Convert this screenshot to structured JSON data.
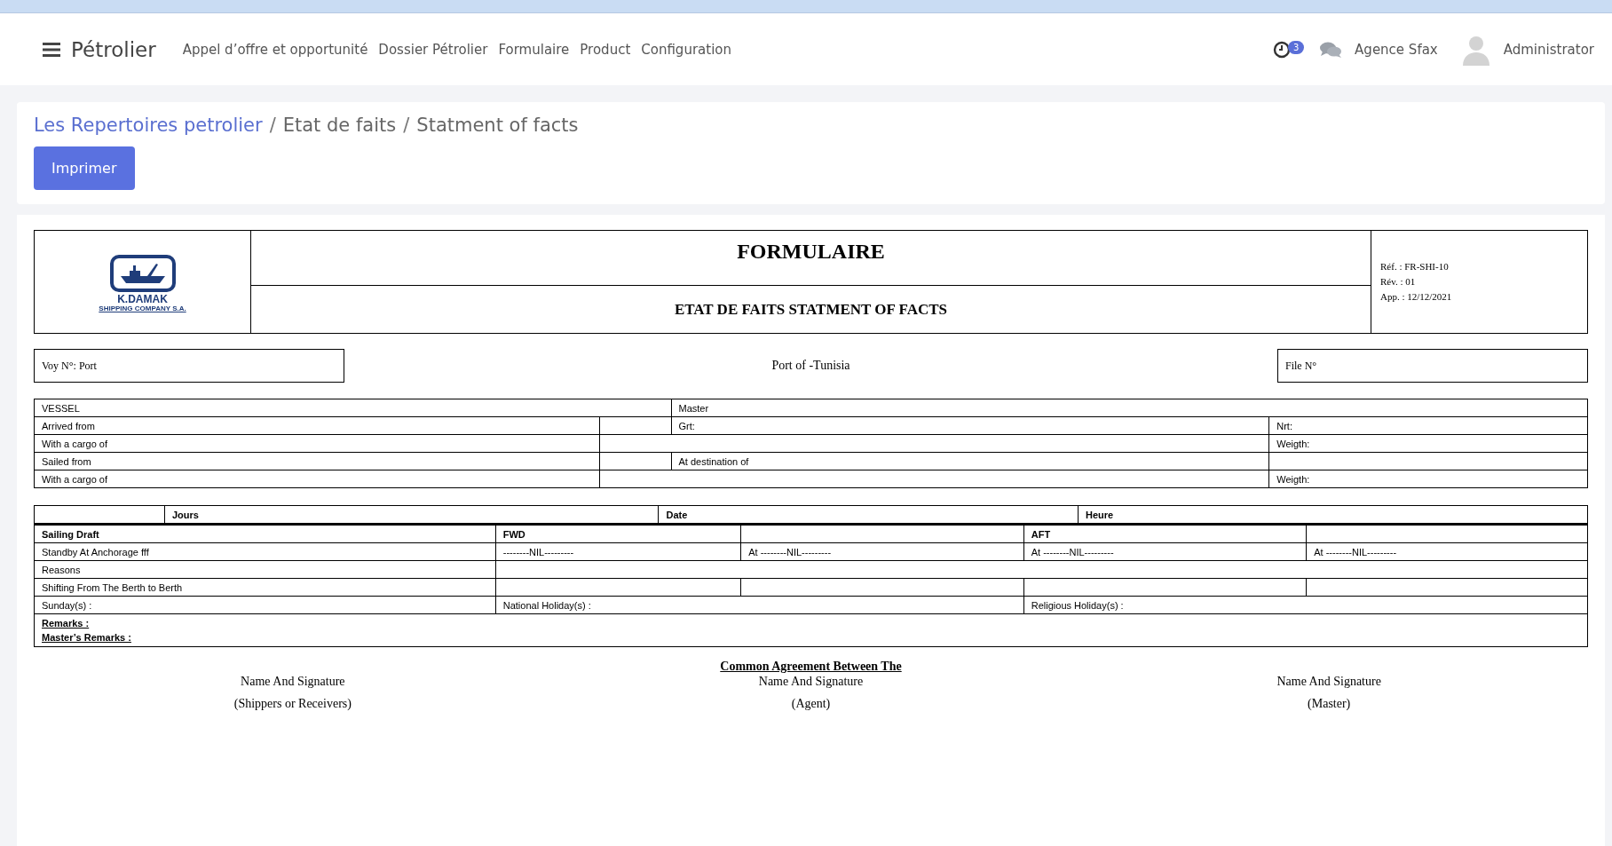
{
  "top_nav": {
    "brand": "Pétrolier",
    "menu": [
      "Appel d’offre et opportunité",
      "Dossier Pétrolier",
      "Formulaire",
      "Product",
      "Configuration"
    ],
    "notification_count": "3",
    "agency": "Agence Sfax",
    "user": "Administrator"
  },
  "breadcrumb_separator": "/",
  "breadcrumb": [
    {
      "label": "Les Repertoires petrolier",
      "link": true
    },
    {
      "label": "Etat de faits",
      "link": false
    },
    {
      "label": "Statment of facts",
      "link": false
    }
  ],
  "print_button": "Imprimer",
  "form": {
    "logo_name": "K.DAMAK",
    "logo_subtitle": "SHIPPING COMPANY S.A.",
    "title": "FORMULAIRE",
    "subtitle": "ETAT DE FAITS STATMENT OF FACTS",
    "ref_lines": [
      "Réf. : FR-SHI-10",
      "Rév. : 01",
      "App. : 12/12/2021"
    ],
    "voy": "Voy N°: Port",
    "port": "Port of -Tunisia",
    "file": "File N°",
    "vessel_rows": [
      [
        {
          "kind": "wide",
          "text": "VESSEL"
        },
        {
          "kind": "wide",
          "text": "Master"
        }
      ],
      [
        {
          "kind": "cell",
          "text": "Arrived from"
        },
        {
          "kind": "blank"
        },
        {
          "kind": "cell",
          "text": "Grt:"
        },
        {
          "kind": "cell",
          "text": "Nrt:"
        }
      ],
      [
        {
          "kind": "cell",
          "text": "With a cargo of"
        },
        {
          "kind": "wideblank"
        },
        {
          "kind": "cell",
          "text": "Weigth:"
        }
      ],
      [
        {
          "kind": "cell",
          "text": "Sailed from"
        },
        {
          "kind": "blank"
        },
        {
          "kind": "cell",
          "text": "At destination of"
        },
        {
          "kind": "blank"
        }
      ],
      [
        {
          "kind": "cell",
          "text": "With a cargo of"
        },
        {
          "kind": "wideblank"
        },
        {
          "kind": "cell",
          "text": "Weigth:"
        }
      ]
    ],
    "time_header": [
      "Jours",
      "Date",
      "Heure"
    ],
    "draft_rows": [
      [
        {
          "kind": "head",
          "text": "Sailing Draft"
        },
        {
          "kind": "head",
          "text": "FWD"
        },
        {
          "kind": "blank"
        },
        {
          "kind": "head",
          "text": "AFT"
        },
        {
          "kind": "blank"
        }
      ],
      [
        {
          "kind": "cell",
          "text": "Standby At Anchorage fff"
        },
        {
          "kind": "cell",
          "text": "--------NIL---------"
        },
        {
          "kind": "cell",
          "text": "At --------NIL---------"
        },
        {
          "kind": "cell",
          "text": "At --------NIL---------"
        },
        {
          "kind": "cell",
          "text": "At --------NIL---------"
        }
      ],
      [
        {
          "kind": "cell",
          "text": "Reasons"
        },
        {
          "kind": "restblank"
        }
      ],
      [
        {
          "kind": "cell",
          "text": "Shifting From The Berth to Berth"
        },
        {
          "kind": "blank"
        },
        {
          "kind": "blank"
        },
        {
          "kind": "blank"
        },
        {
          "kind": "blank"
        }
      ],
      [
        {
          "kind": "cell",
          "text": "Sunday(s) :"
        },
        {
          "kind": "wide",
          "text": "National Holiday(s) :"
        },
        {
          "kind": "wide",
          "text": "Religious Holiday(s) :"
        }
      ]
    ],
    "remarks": [
      "Remarks :",
      "Master’s Remarks :"
    ],
    "agreement": "Common Agreement Between The",
    "signatures": [
      {
        "name": "Name And Signature",
        "role": "(Shippers or Receivers)"
      },
      {
        "name": "Name And Signature",
        "role": "(Agent)"
      },
      {
        "name": "Name And Signature",
        "role": "(Master)"
      }
    ]
  }
}
